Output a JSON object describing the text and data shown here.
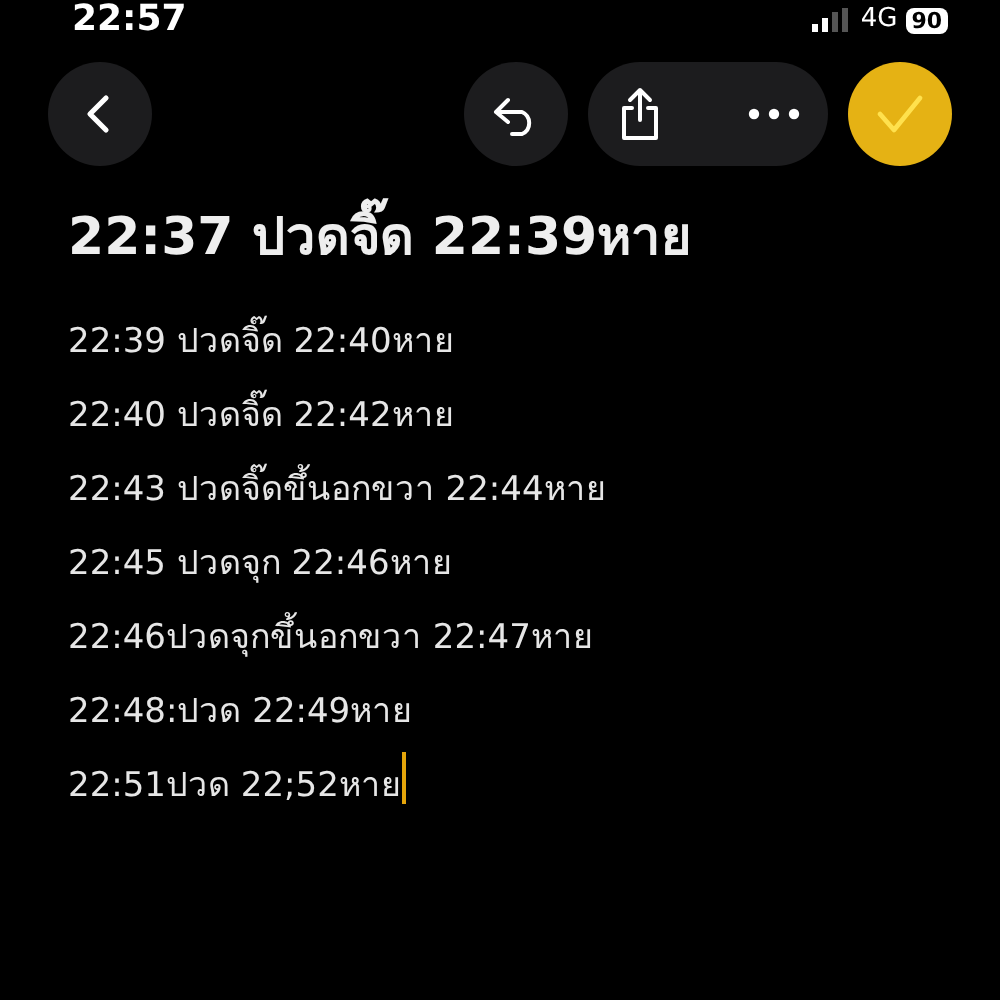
{
  "status_bar": {
    "time": "22:57",
    "network": "4G",
    "battery": "90"
  },
  "toolbar": {
    "buttons": [
      {
        "kind": "back"
      },
      {
        "kind": "undo"
      },
      {
        "kind": "share"
      },
      {
        "kind": "more"
      },
      {
        "kind": "done"
      }
    ]
  },
  "note": {
    "title": "22:37 ปวดจิ๊ด 22:39หาย",
    "lines": [
      "22:39 ปวดจิ๊ด 22:40หาย",
      "22:40 ปวดจิ๊ด 22:42หาย",
      "22:43 ปวดจิ๊ดขึ้นอกขวา 22:44หาย",
      "22:45 ปวดจุก 22:46หาย",
      "22:46ปวดจุกขึ้นอกขวา 22:47หาย",
      "22:48:ปวด 22:49หาย",
      "22:51ปวด 22;52หาย"
    ]
  }
}
